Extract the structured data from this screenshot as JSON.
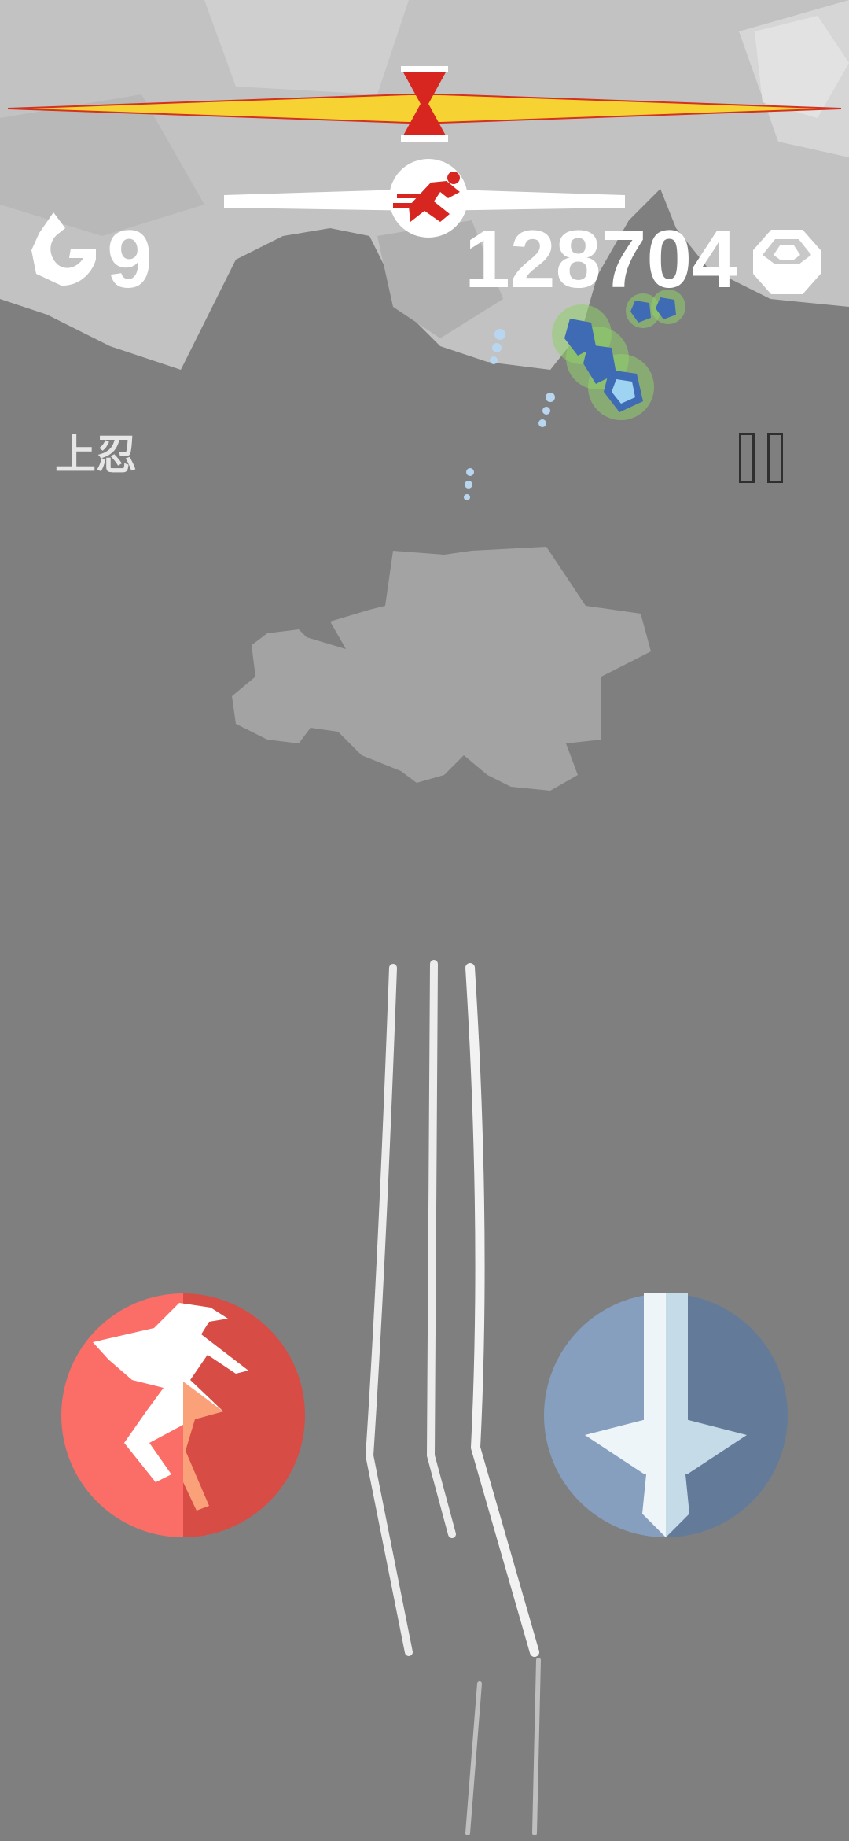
{
  "hud": {
    "shuriken_icon": "shuriken-icon",
    "shuriken_count": "9",
    "score": "128704",
    "coin_icon": "octagon-coin-icon",
    "rank_label": "上忍",
    "pause_icon": "pause-icon"
  },
  "progress": {
    "boss_bar_fill": 1.0,
    "run_bar_fill": 1.0,
    "runner_icon": "running-ninja-icon",
    "hourglass_icon": "hourglass-icon"
  },
  "controls": {
    "jump_icon": "ninja-jump-icon",
    "attack_icon": "sword-icon"
  },
  "colors": {
    "background": "#7f7f7f",
    "boss_bar": "#f6d233",
    "accent_red": "#d7261f",
    "jump_button": "#fb6e67",
    "attack_button": "#7d95b6"
  }
}
